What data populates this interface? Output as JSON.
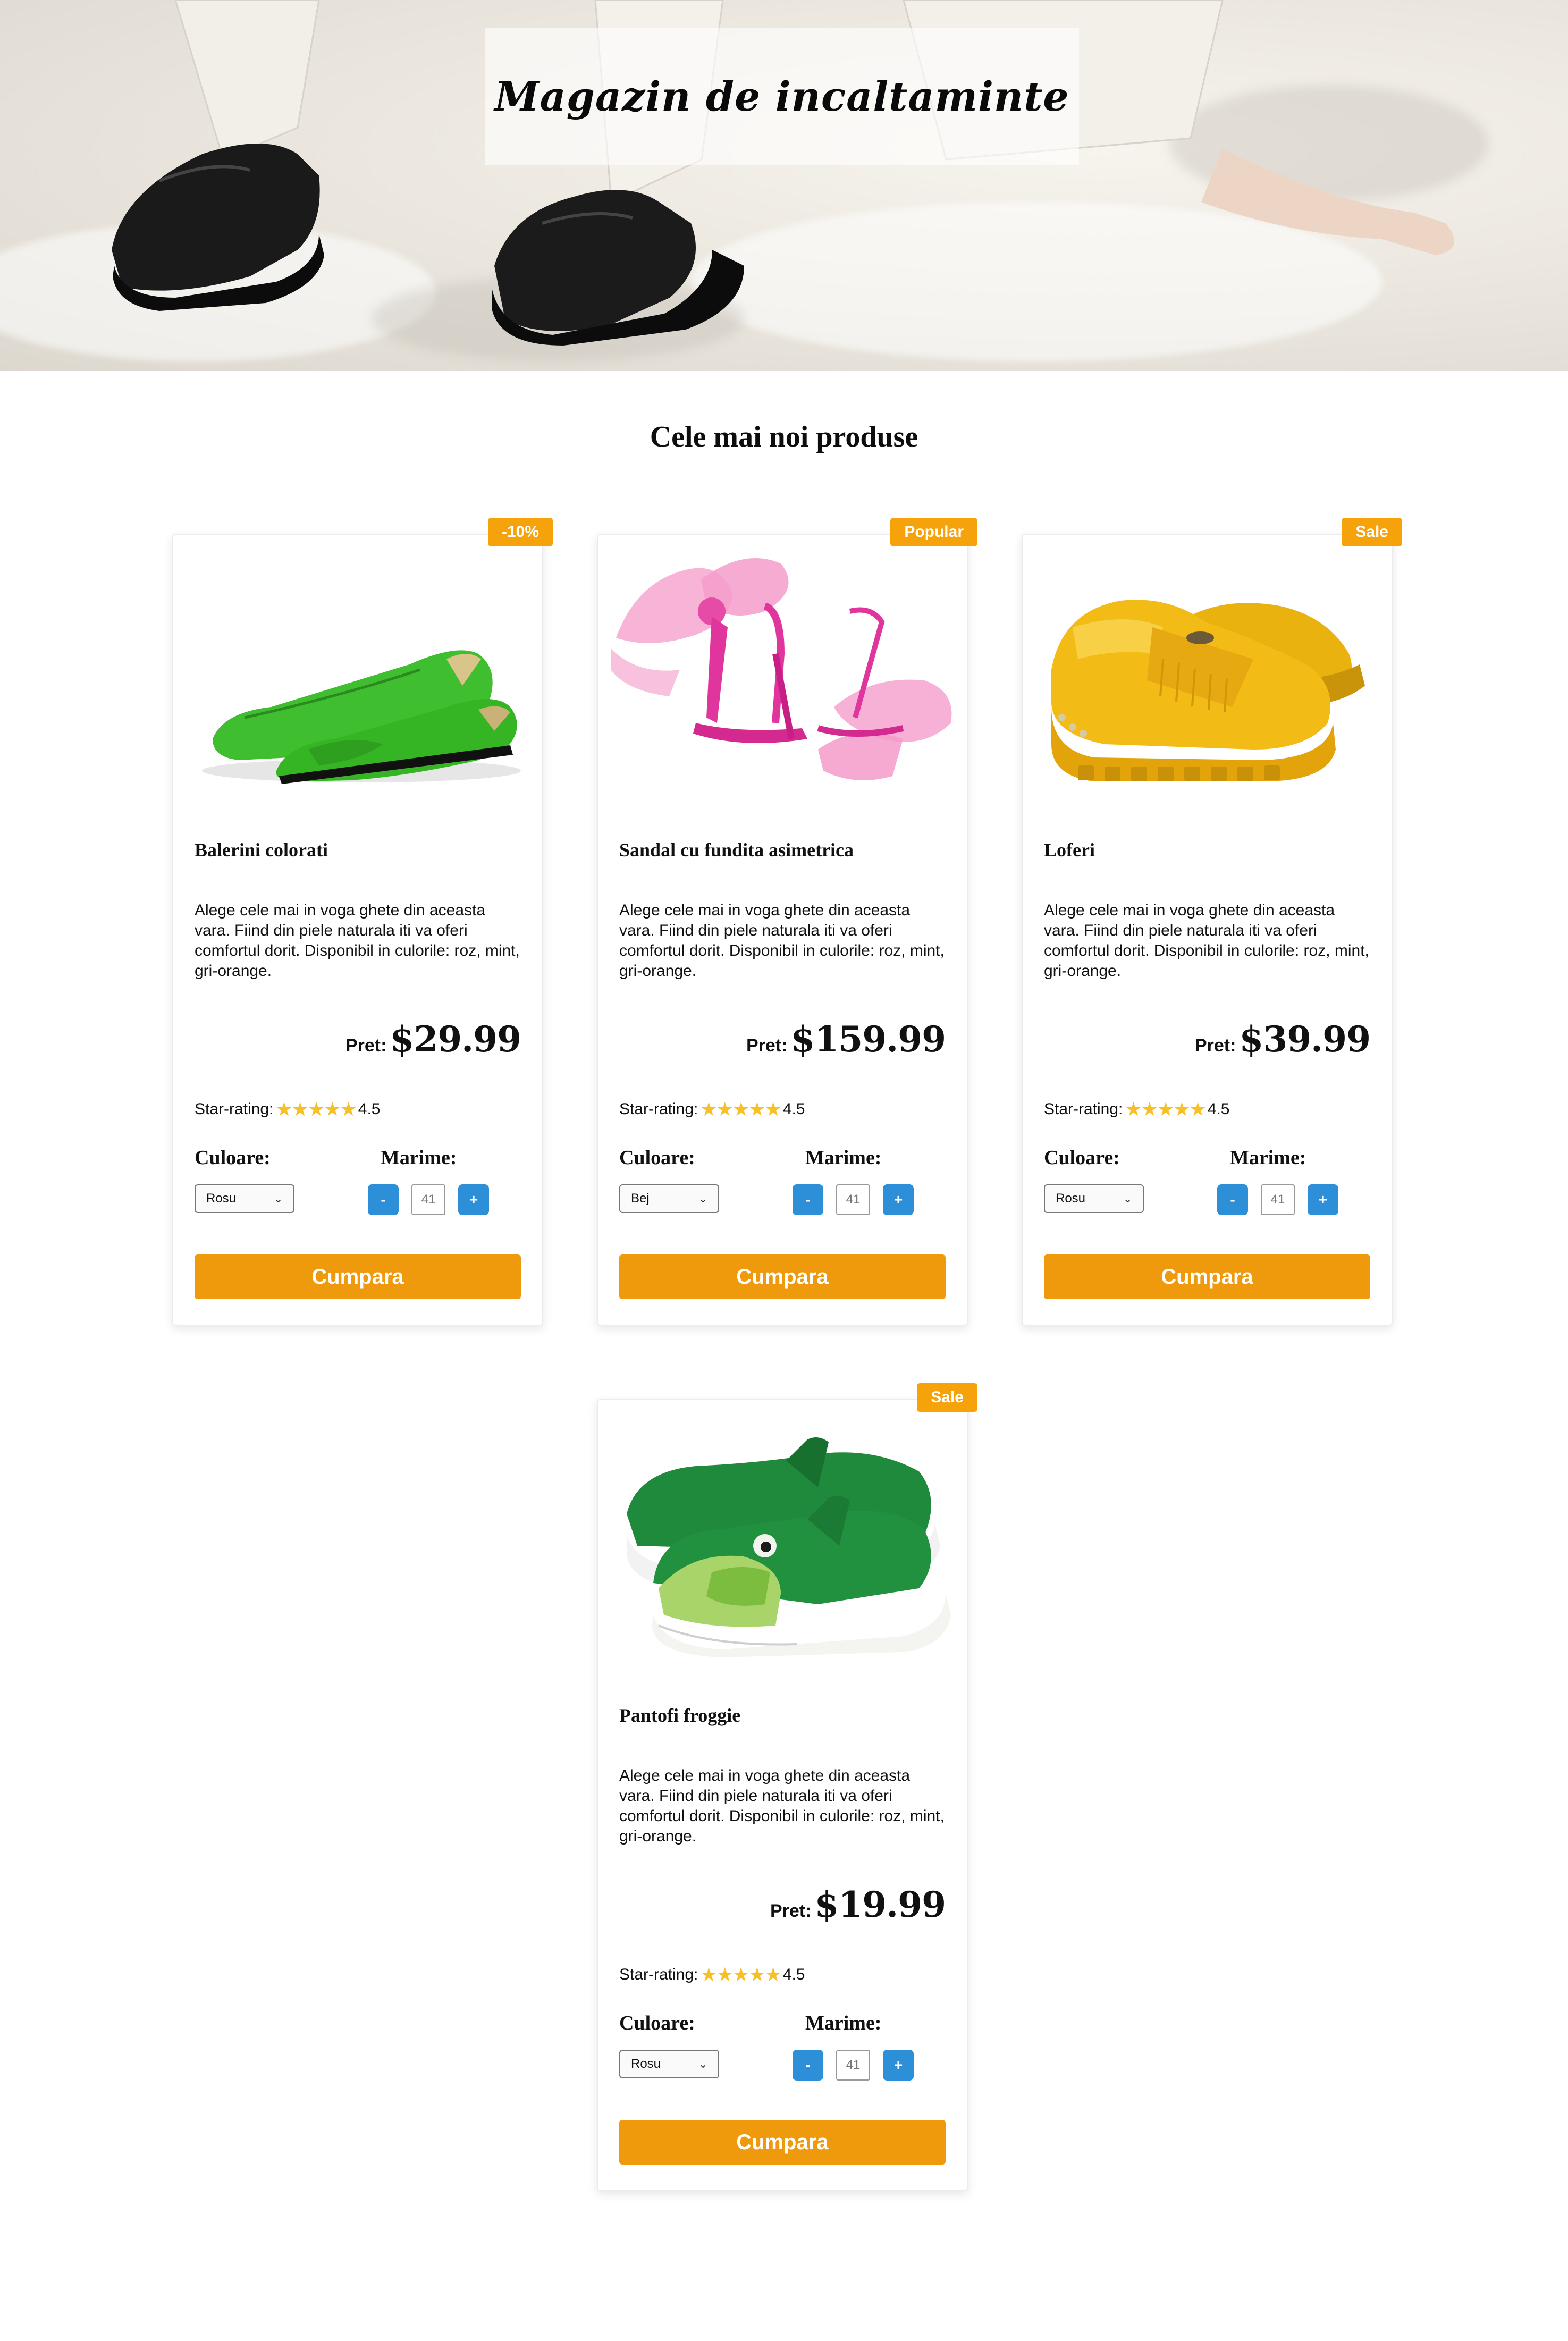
{
  "hero": {
    "title": "Magazin de incaltaminte"
  },
  "section": {
    "title": "Cele mai noi produse"
  },
  "colors": {
    "accent": "#ef9a0d",
    "badge": "#f6a20a",
    "qty_button": "#2d8fd8",
    "star": "#f6c026"
  },
  "products": [
    {
      "badge": "-10%",
      "name": "Balerini colorati",
      "image": "green-ballet-flats-image",
      "description": "Alege cele mai in voga ghete din aceasta vara. Fiind din piele naturala iti va oferi comfortul dorit. Disponibil in culorile: roz, mint, gri-orange.",
      "price_label": "Pret:",
      "price": "$29.99",
      "rating_label": "Star-rating:",
      "stars": "★★★★★",
      "rating": "4.5",
      "color_label": "Culoare:",
      "color_value": "Rosu",
      "size_label": "Marime:",
      "size_minus": "-",
      "size_value": "41",
      "size_plus": "+",
      "buy_label": "Cumpara"
    },
    {
      "badge": "Popular",
      "name": "Sandal cu fundita asimetrica",
      "image": "pink-bow-sandals-image",
      "description": "Alege cele mai in voga ghete din aceasta vara. Fiind din piele naturala iti va oferi comfortul dorit. Disponibil in culorile: roz, mint, gri-orange.",
      "price_label": "Pret:",
      "price": "$159.99",
      "rating_label": "Star-rating:",
      "stars": "★★★★★",
      "rating": "4.5",
      "color_label": "Culoare:",
      "color_value": "Bej",
      "size_label": "Marime:",
      "size_minus": "-",
      "size_value": "41",
      "size_plus": "+",
      "buy_label": "Cumpara"
    },
    {
      "badge": "Sale",
      "name": "Loferi",
      "image": "yellow-loafers-image",
      "description": "Alege cele mai in voga ghete din aceasta vara. Fiind din piele naturala iti va oferi comfortul dorit. Disponibil in culorile: roz, mint, gri-orange.",
      "price_label": "Pret:",
      "price": "$39.99",
      "rating_label": "Star-rating:",
      "stars": "★★★★★",
      "rating": "4.5",
      "color_label": "Culoare:",
      "color_value": "Rosu",
      "size_label": "Marime:",
      "size_minus": "-",
      "size_value": "41",
      "size_plus": "+",
      "buy_label": "Cumpara"
    },
    {
      "badge": "Sale",
      "name": "Pantofi froggie",
      "image": "frog-kids-shoes-image",
      "description": "Alege cele mai in voga ghete din aceasta vara. Fiind din piele naturala iti va oferi comfortul dorit. Disponibil in culorile: roz, mint, gri-orange.",
      "price_label": "Pret:",
      "price": "$19.99",
      "rating_label": "Star-rating:",
      "stars": "★★★★★",
      "rating": "4.5",
      "color_label": "Culoare:",
      "color_value": "Rosu",
      "size_label": "Marime:",
      "size_minus": "-",
      "size_value": "41",
      "size_plus": "+",
      "buy_label": "Cumpara"
    }
  ]
}
